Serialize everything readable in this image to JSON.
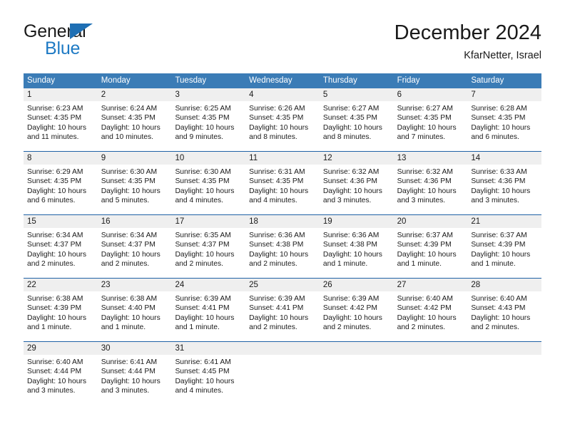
{
  "brand": {
    "name_top": "General",
    "name_bottom": "Blue",
    "flag_icon": "blue-triangle-flag",
    "color_top": "#1a1a1a",
    "color_bottom": "#1e7ac4"
  },
  "header": {
    "title": "December 2024",
    "subtitle": "KfarNetter, Israel"
  },
  "theme": {
    "header_blue": "#3b7cb6",
    "row_rule_blue": "#1f62a5",
    "day_band_gray": "#efefef",
    "text": "#1a1a1a"
  },
  "weekdays": [
    "Sunday",
    "Monday",
    "Tuesday",
    "Wednesday",
    "Thursday",
    "Friday",
    "Saturday"
  ],
  "weeks": [
    [
      {
        "day": "1",
        "sunrise": "Sunrise: 6:23 AM",
        "sunset": "Sunset: 4:35 PM",
        "daylight1": "Daylight: 10 hours",
        "daylight2": "and 11 minutes."
      },
      {
        "day": "2",
        "sunrise": "Sunrise: 6:24 AM",
        "sunset": "Sunset: 4:35 PM",
        "daylight1": "Daylight: 10 hours",
        "daylight2": "and 10 minutes."
      },
      {
        "day": "3",
        "sunrise": "Sunrise: 6:25 AM",
        "sunset": "Sunset: 4:35 PM",
        "daylight1": "Daylight: 10 hours",
        "daylight2": "and 9 minutes."
      },
      {
        "day": "4",
        "sunrise": "Sunrise: 6:26 AM",
        "sunset": "Sunset: 4:35 PM",
        "daylight1": "Daylight: 10 hours",
        "daylight2": "and 8 minutes."
      },
      {
        "day": "5",
        "sunrise": "Sunrise: 6:27 AM",
        "sunset": "Sunset: 4:35 PM",
        "daylight1": "Daylight: 10 hours",
        "daylight2": "and 8 minutes."
      },
      {
        "day": "6",
        "sunrise": "Sunrise: 6:27 AM",
        "sunset": "Sunset: 4:35 PM",
        "daylight1": "Daylight: 10 hours",
        "daylight2": "and 7 minutes."
      },
      {
        "day": "7",
        "sunrise": "Sunrise: 6:28 AM",
        "sunset": "Sunset: 4:35 PM",
        "daylight1": "Daylight: 10 hours",
        "daylight2": "and 6 minutes."
      }
    ],
    [
      {
        "day": "8",
        "sunrise": "Sunrise: 6:29 AM",
        "sunset": "Sunset: 4:35 PM",
        "daylight1": "Daylight: 10 hours",
        "daylight2": "and 6 minutes."
      },
      {
        "day": "9",
        "sunrise": "Sunrise: 6:30 AM",
        "sunset": "Sunset: 4:35 PM",
        "daylight1": "Daylight: 10 hours",
        "daylight2": "and 5 minutes."
      },
      {
        "day": "10",
        "sunrise": "Sunrise: 6:30 AM",
        "sunset": "Sunset: 4:35 PM",
        "daylight1": "Daylight: 10 hours",
        "daylight2": "and 4 minutes."
      },
      {
        "day": "11",
        "sunrise": "Sunrise: 6:31 AM",
        "sunset": "Sunset: 4:35 PM",
        "daylight1": "Daylight: 10 hours",
        "daylight2": "and 4 minutes."
      },
      {
        "day": "12",
        "sunrise": "Sunrise: 6:32 AM",
        "sunset": "Sunset: 4:36 PM",
        "daylight1": "Daylight: 10 hours",
        "daylight2": "and 3 minutes."
      },
      {
        "day": "13",
        "sunrise": "Sunrise: 6:32 AM",
        "sunset": "Sunset: 4:36 PM",
        "daylight1": "Daylight: 10 hours",
        "daylight2": "and 3 minutes."
      },
      {
        "day": "14",
        "sunrise": "Sunrise: 6:33 AM",
        "sunset": "Sunset: 4:36 PM",
        "daylight1": "Daylight: 10 hours",
        "daylight2": "and 3 minutes."
      }
    ],
    [
      {
        "day": "15",
        "sunrise": "Sunrise: 6:34 AM",
        "sunset": "Sunset: 4:37 PM",
        "daylight1": "Daylight: 10 hours",
        "daylight2": "and 2 minutes."
      },
      {
        "day": "16",
        "sunrise": "Sunrise: 6:34 AM",
        "sunset": "Sunset: 4:37 PM",
        "daylight1": "Daylight: 10 hours",
        "daylight2": "and 2 minutes."
      },
      {
        "day": "17",
        "sunrise": "Sunrise: 6:35 AM",
        "sunset": "Sunset: 4:37 PM",
        "daylight1": "Daylight: 10 hours",
        "daylight2": "and 2 minutes."
      },
      {
        "day": "18",
        "sunrise": "Sunrise: 6:36 AM",
        "sunset": "Sunset: 4:38 PM",
        "daylight1": "Daylight: 10 hours",
        "daylight2": "and 2 minutes."
      },
      {
        "day": "19",
        "sunrise": "Sunrise: 6:36 AM",
        "sunset": "Sunset: 4:38 PM",
        "daylight1": "Daylight: 10 hours",
        "daylight2": "and 1 minute."
      },
      {
        "day": "20",
        "sunrise": "Sunrise: 6:37 AM",
        "sunset": "Sunset: 4:39 PM",
        "daylight1": "Daylight: 10 hours",
        "daylight2": "and 1 minute."
      },
      {
        "day": "21",
        "sunrise": "Sunrise: 6:37 AM",
        "sunset": "Sunset: 4:39 PM",
        "daylight1": "Daylight: 10 hours",
        "daylight2": "and 1 minute."
      }
    ],
    [
      {
        "day": "22",
        "sunrise": "Sunrise: 6:38 AM",
        "sunset": "Sunset: 4:39 PM",
        "daylight1": "Daylight: 10 hours",
        "daylight2": "and 1 minute."
      },
      {
        "day": "23",
        "sunrise": "Sunrise: 6:38 AM",
        "sunset": "Sunset: 4:40 PM",
        "daylight1": "Daylight: 10 hours",
        "daylight2": "and 1 minute."
      },
      {
        "day": "24",
        "sunrise": "Sunrise: 6:39 AM",
        "sunset": "Sunset: 4:41 PM",
        "daylight1": "Daylight: 10 hours",
        "daylight2": "and 1 minute."
      },
      {
        "day": "25",
        "sunrise": "Sunrise: 6:39 AM",
        "sunset": "Sunset: 4:41 PM",
        "daylight1": "Daylight: 10 hours",
        "daylight2": "and 2 minutes."
      },
      {
        "day": "26",
        "sunrise": "Sunrise: 6:39 AM",
        "sunset": "Sunset: 4:42 PM",
        "daylight1": "Daylight: 10 hours",
        "daylight2": "and 2 minutes."
      },
      {
        "day": "27",
        "sunrise": "Sunrise: 6:40 AM",
        "sunset": "Sunset: 4:42 PM",
        "daylight1": "Daylight: 10 hours",
        "daylight2": "and 2 minutes."
      },
      {
        "day": "28",
        "sunrise": "Sunrise: 6:40 AM",
        "sunset": "Sunset: 4:43 PM",
        "daylight1": "Daylight: 10 hours",
        "daylight2": "and 2 minutes."
      }
    ],
    [
      {
        "day": "29",
        "sunrise": "Sunrise: 6:40 AM",
        "sunset": "Sunset: 4:44 PM",
        "daylight1": "Daylight: 10 hours",
        "daylight2": "and 3 minutes."
      },
      {
        "day": "30",
        "sunrise": "Sunrise: 6:41 AM",
        "sunset": "Sunset: 4:44 PM",
        "daylight1": "Daylight: 10 hours",
        "daylight2": "and 3 minutes."
      },
      {
        "day": "31",
        "sunrise": "Sunrise: 6:41 AM",
        "sunset": "Sunset: 4:45 PM",
        "daylight1": "Daylight: 10 hours",
        "daylight2": "and 4 minutes."
      },
      {
        "day": "",
        "sunrise": "",
        "sunset": "",
        "daylight1": "",
        "daylight2": ""
      },
      {
        "day": "",
        "sunrise": "",
        "sunset": "",
        "daylight1": "",
        "daylight2": ""
      },
      {
        "day": "",
        "sunrise": "",
        "sunset": "",
        "daylight1": "",
        "daylight2": ""
      },
      {
        "day": "",
        "sunrise": "",
        "sunset": "",
        "daylight1": "",
        "daylight2": ""
      }
    ]
  ]
}
